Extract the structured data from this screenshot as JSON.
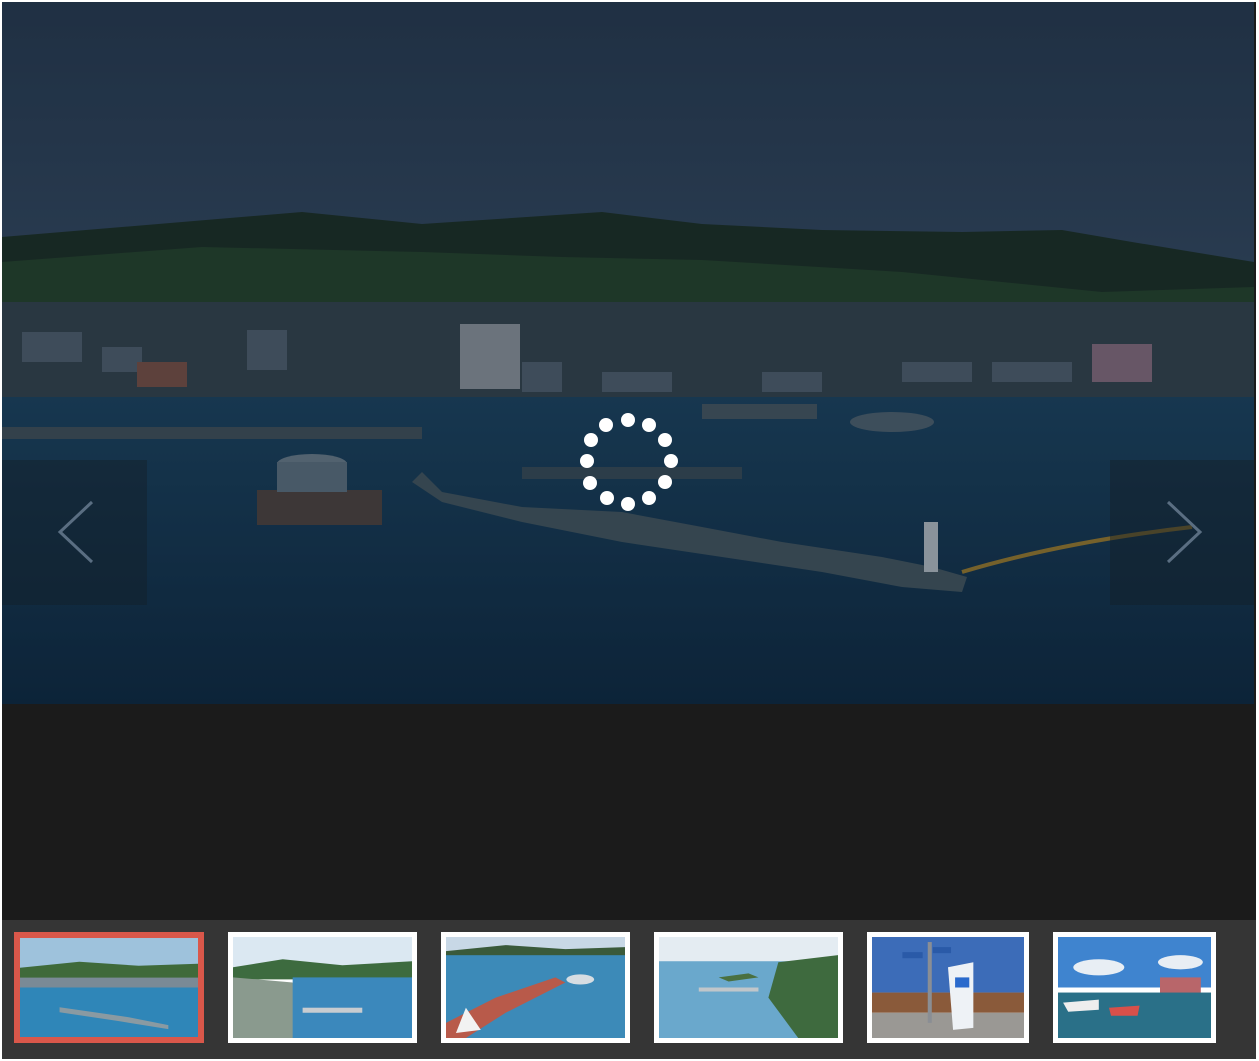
{
  "gallery": {
    "main_image": {
      "name": "harbor-aerial-photo"
    },
    "overlay_color": "#0a1423",
    "loading_spinner": {
      "icon": "loading-spinner-icon",
      "color": "#ffffff"
    },
    "nav": {
      "prev_icon": "chevron-left-icon",
      "next_icon": "chevron-right-icon"
    },
    "thumbnails": [
      {
        "name": "thumbnail-1",
        "active": true
      },
      {
        "name": "thumbnail-2",
        "active": false
      },
      {
        "name": "thumbnail-3",
        "active": false
      },
      {
        "name": "thumbnail-4",
        "active": false
      },
      {
        "name": "thumbnail-5",
        "active": false
      },
      {
        "name": "thumbnail-6",
        "active": false
      }
    ],
    "colors": {
      "active_thumb_border": "#d9574a",
      "thumb_border": "#ffffff",
      "strip_background": "#353535",
      "caption_background": "#1b1b1b"
    }
  }
}
